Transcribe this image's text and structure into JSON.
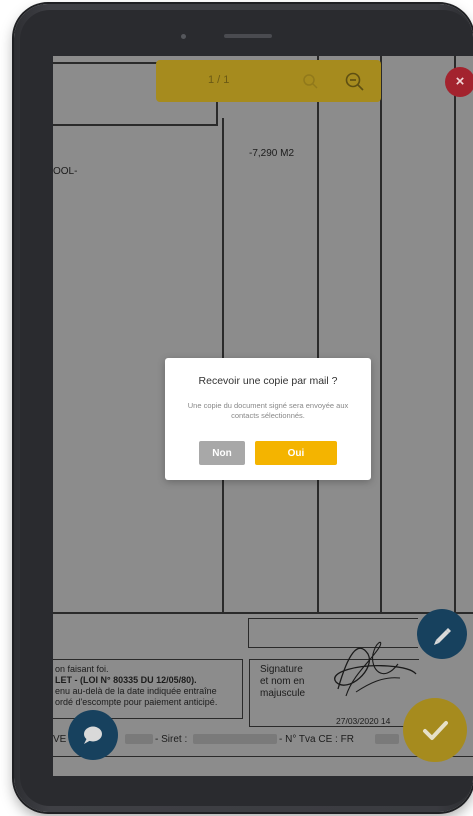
{
  "toolbar": {
    "page_indicator": "1 / 1",
    "zoom_out_icon": "zoom-out-icon",
    "close_icon": "close-icon",
    "accent": "#f4b400",
    "close_color": "#e53946"
  },
  "document": {
    "quantity": "-7,290 M2",
    "fragment_left": "OOL-",
    "footer_line_1": "on faisant foi.",
    "footer_line_2": "LET - (LOI N° 80335 DU 12/05/80).",
    "footer_line_3": "enu au-delà de la date indiquée entraîne",
    "footer_line_4": "ordé d'escompte pour paiement anticipé.",
    "signature_label_1": "Signature",
    "signature_label_2": "et nom en",
    "signature_label_3": "majuscule",
    "signature_date": "27/03/2020 14",
    "bottom_ve": "VE",
    "bottom_siret": "- Siret :",
    "bottom_tva": "- N° Tva CE : FR"
  },
  "modal": {
    "title": "Recevoir une copie par mail ?",
    "message": "Une copie du document signé sera envoyée aux contacts sélectionnés.",
    "no_label": "Non",
    "yes_label": "Oui",
    "no_color": "#a8a8a8",
    "yes_color": "#f4b400"
  },
  "fabs": {
    "pen_icon": "pen-icon",
    "chat_icon": "chat-icon",
    "validate_icon": "check-icon",
    "pen_color": "#1f5b85",
    "validate_color": "#f4b400"
  }
}
